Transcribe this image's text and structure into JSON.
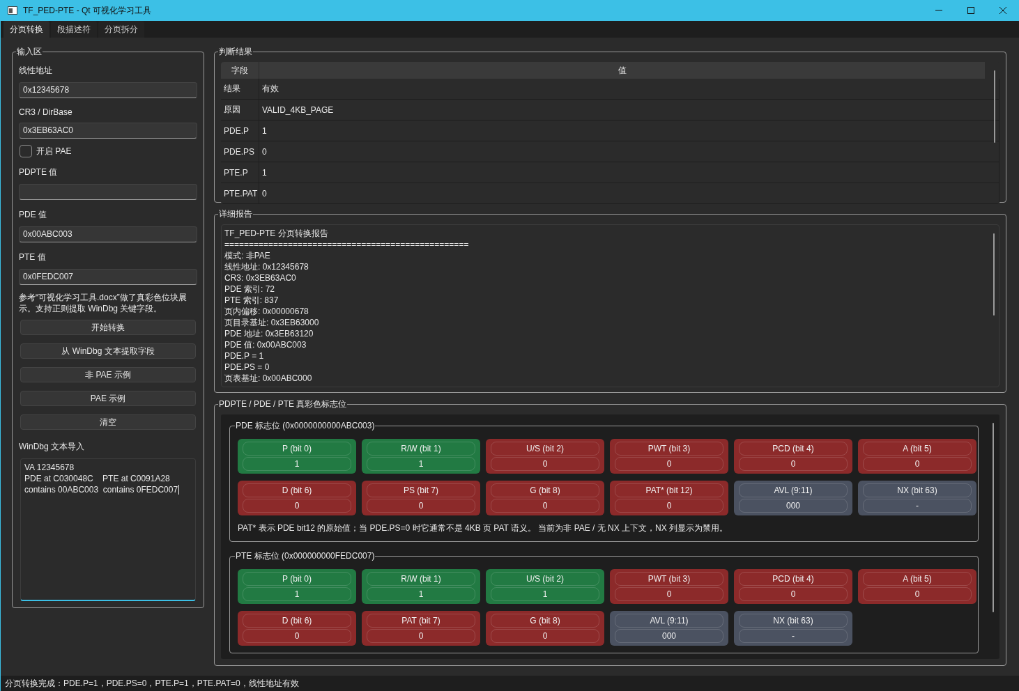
{
  "window": {
    "title": "TF_PED-PTE - Qt 可视化学习工具"
  },
  "tabs": [
    {
      "label": "分页转换",
      "selected": true
    },
    {
      "label": "段描述符",
      "selected": false
    },
    {
      "label": "分页拆分",
      "selected": false
    }
  ],
  "input_panel": {
    "title": "输入区",
    "fields": [
      {
        "label": "线性地址",
        "value": "0x12345678"
      },
      {
        "label": "CR3 / DirBase",
        "value": "0x3EB63AC0"
      }
    ],
    "pae_checkbox": {
      "label": "开启 PAE",
      "checked": false
    },
    "fields_after": [
      {
        "label": "PDPTE 值"
      },
      {
        "label": "PDE 值",
        "value": "0x00ABC003"
      },
      {
        "label": "PTE 值",
        "value": "0x0FEDC007"
      }
    ],
    "note": "参考“可视化学习工具.docx”做了真彩色位块展示。支持正则提取 WinDbg 关键字段。",
    "buttons": [
      "开始转换",
      "从 WinDbg 文本提取字段",
      "非 PAE 示例",
      "PAE 示例",
      "清空"
    ],
    "import_label": "WinDbg 文本导入",
    "import_text": "VA 12345678\nPDE at C030048C    PTE at C0091A28\ncontains 00ABC003  contains 0FEDC007"
  },
  "result": {
    "title": "判断结果",
    "columns": [
      "字段",
      "值"
    ],
    "rows": [
      [
        "结果",
        "有效"
      ],
      [
        "原因",
        "VALID_4KB_PAGE"
      ],
      [
        "PDE.P",
        "1"
      ],
      [
        "PDE.PS",
        "0"
      ],
      [
        "PTE.P",
        "1"
      ],
      [
        "PTE.PAT",
        "0"
      ]
    ]
  },
  "report": {
    "title": "详细报告",
    "lines": [
      "TF_PED-PTE 分页转换报告",
      "==================================================",
      "模式: 非PAE",
      "线性地址: 0x12345678",
      "CR3: 0x3EB63AC0",
      "PDE 索引: 72",
      "PTE 索引: 837",
      "页内偏移: 0x00000678",
      "页目录基址: 0x3EB63000",
      "PDE 地址: 0x3EB63120",
      "PDE 值: 0x00ABC003",
      "PDE.P = 1",
      "PDE.PS = 0",
      "页表基址: 0x00ABC000"
    ]
  },
  "flags": {
    "title": "PDPTE / PDE / PTE 真彩色标志位",
    "groups": [
      {
        "title": "PDE 标志位 (0x0000000000ABC003)",
        "tiles": [
          {
            "name": "P (bit 0)",
            "value": "1",
            "color": "#227a43"
          },
          {
            "name": "R/W (bit 1)",
            "value": "1",
            "color": "#227a43"
          },
          {
            "name": "U/S (bit 2)",
            "value": "0",
            "color": "#8c2a2a"
          },
          {
            "name": "PWT (bit 3)",
            "value": "0",
            "color": "#8c2a2a"
          },
          {
            "name": "PCD (bit 4)",
            "value": "0",
            "color": "#8c2a2a"
          },
          {
            "name": "A (bit 5)",
            "value": "0",
            "color": "#8c2a2a"
          },
          {
            "name": "D (bit 6)",
            "value": "0",
            "color": "#8c2a2a"
          },
          {
            "name": "PS (bit 7)",
            "value": "0",
            "color": "#8c2a2a"
          },
          {
            "name": "G (bit 8)",
            "value": "0",
            "color": "#8c2a2a"
          },
          {
            "name": "PAT* (bit 12)",
            "value": "0",
            "color": "#8c2a2a"
          },
          {
            "name": "AVL (9:11)",
            "value": "000",
            "color": "#4b5261"
          },
          {
            "name": "NX (bit 63)",
            "value": "-",
            "color": "#4b5261"
          }
        ],
        "note": "PAT* 表示 PDE bit12 的原始值；当 PDE.PS=0 时它通常不是 4KB 页 PAT 语义。 当前为非 PAE / 无 NX 上下文，NX 列显示为禁用。"
      },
      {
        "title": "PTE 标志位 (0x000000000FEDC007)",
        "tiles": [
          {
            "name": "P (bit 0)",
            "value": "1",
            "color": "#227a43"
          },
          {
            "name": "R/W (bit 1)",
            "value": "1",
            "color": "#227a43"
          },
          {
            "name": "U/S (bit 2)",
            "value": "1",
            "color": "#227a43"
          },
          {
            "name": "PWT (bit 3)",
            "value": "0",
            "color": "#8c2a2a"
          },
          {
            "name": "PCD (bit 4)",
            "value": "0",
            "color": "#8c2a2a"
          },
          {
            "name": "A (bit 5)",
            "value": "0",
            "color": "#8c2a2a"
          },
          {
            "name": "D (bit 6)",
            "value": "0",
            "color": "#8c2a2a"
          },
          {
            "name": "PAT (bit 7)",
            "value": "0",
            "color": "#8c2a2a"
          },
          {
            "name": "G (bit 8)",
            "value": "0",
            "color": "#8c2a2a"
          },
          {
            "name": "AVL (9:11)",
            "value": "000",
            "color": "#4b5261"
          },
          {
            "name": "NX (bit 63)",
            "value": "-",
            "color": "#4b5261"
          }
        ]
      }
    ]
  },
  "status_bar": "分页转换完成：PDE.P=1，PDE.PS=0，PTE.P=1，PTE.PAT=0，线性地址有效"
}
